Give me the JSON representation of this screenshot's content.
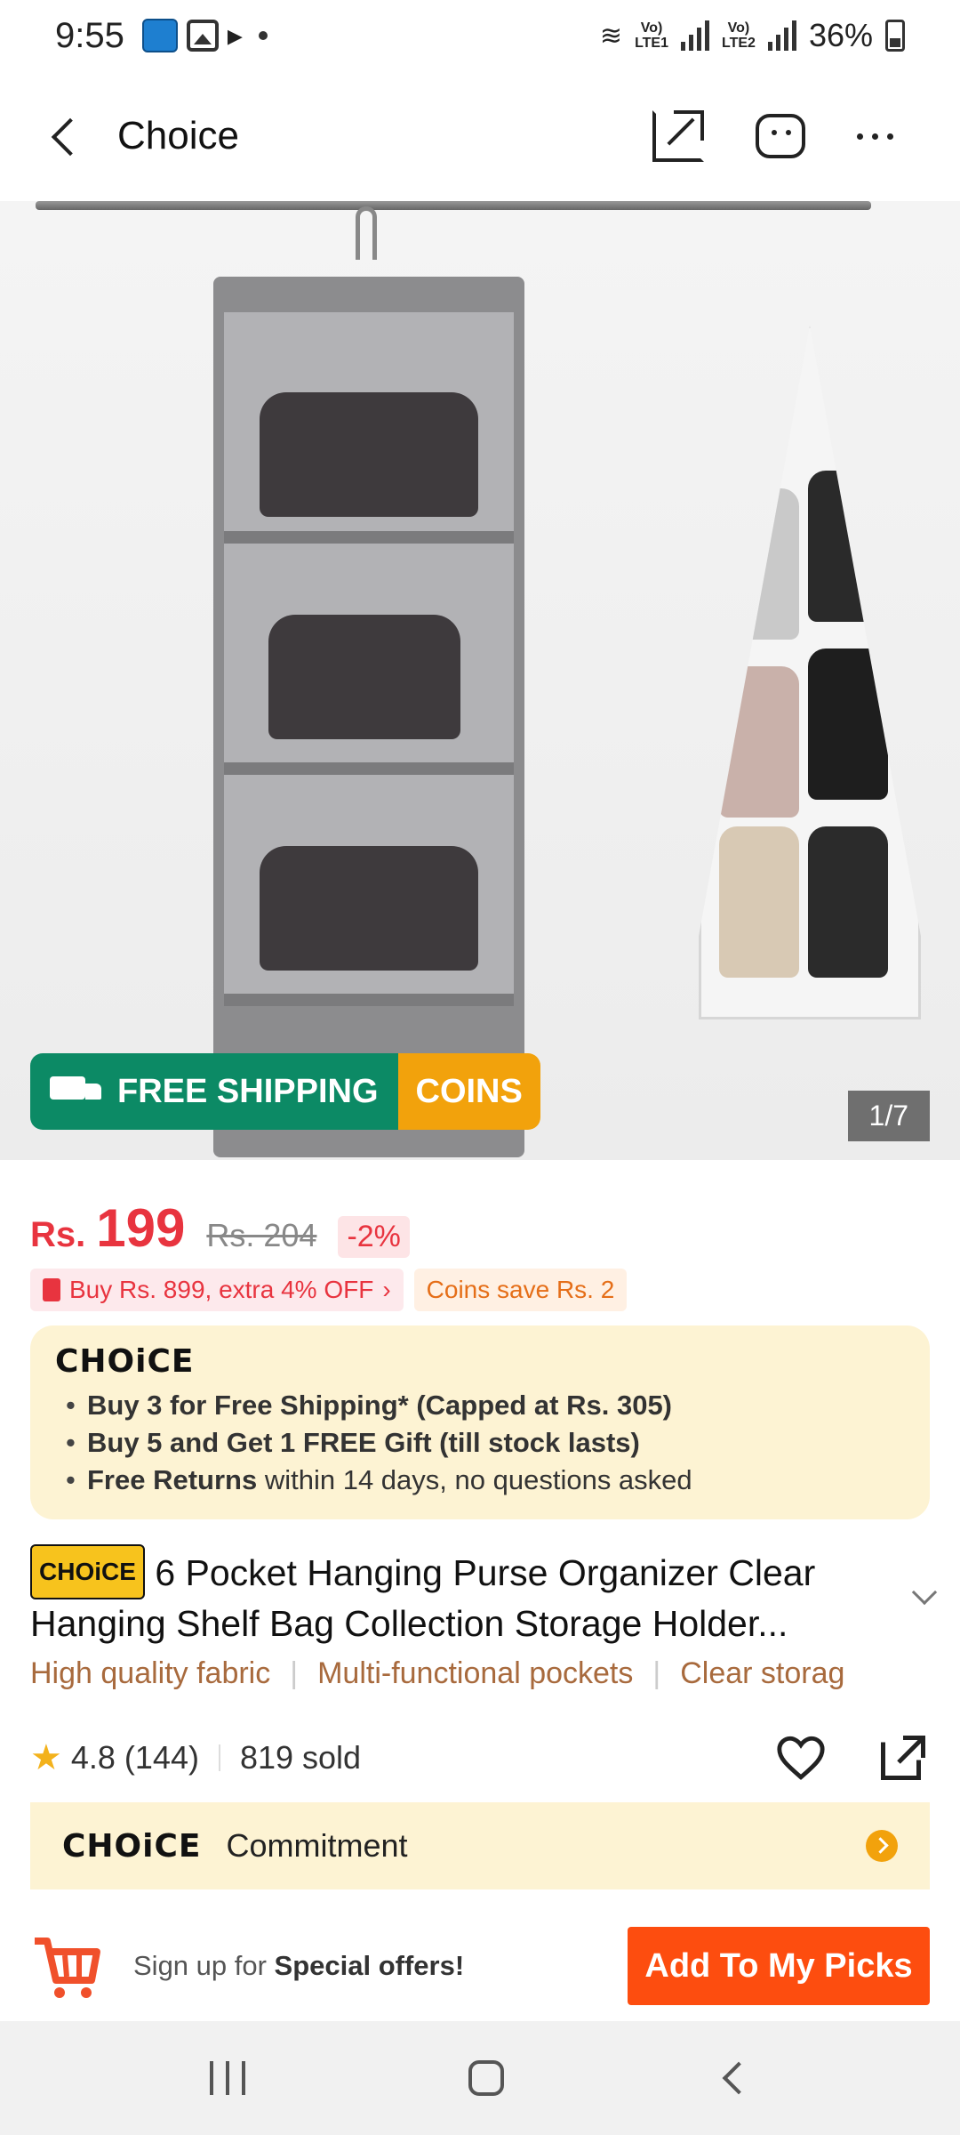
{
  "status_bar": {
    "time": "9:55",
    "lte1": "Vo)\nLTE1",
    "lte2": "Vo)\nLTE2",
    "battery": "36%"
  },
  "header": {
    "title": "Choice",
    "icons": [
      "back-icon",
      "share-icon",
      "customer-service-icon",
      "more-icon"
    ]
  },
  "gallery": {
    "banner_free_shipping": "FREE SHIPPING",
    "banner_free_tag": "FREE",
    "banner_coins": "COINS",
    "counter": "1/7"
  },
  "price": {
    "currency": "Rs.",
    "value": "199",
    "original": "Rs. 204",
    "discount": "-2%"
  },
  "promos": {
    "bundle": "Buy Rs. 899, extra 4% OFF",
    "coins": "Coins save Rs. 2"
  },
  "choice_card": {
    "logo": "CHOiCE",
    "line1": "Buy 3 for  Free Shipping* (Capped at Rs. 305)",
    "line2": "Buy 5 and Get 1 FREE Gift (till stock lasts)",
    "line3_bold": "Free Returns",
    "line3_rest": " within 14 days, no questions asked"
  },
  "product": {
    "badge": "CHOiCE",
    "title": "6 Pocket Hanging Purse Organizer Clear Hanging Shelf Bag Collection Storage Holder..."
  },
  "features": [
    "High quality fabric",
    "Multi-functional pockets",
    "Clear storag"
  ],
  "rating": {
    "score": "4.8",
    "count": "(144)",
    "sold": "819 sold"
  },
  "commitment": {
    "logo": "CHOiCE",
    "label": "Commitment"
  },
  "bottom": {
    "signup_prefix": "Sign up for ",
    "signup_bold": "Special offers!",
    "add_button": "Add To My Picks"
  },
  "colors": {
    "price_red": "#e8343f",
    "ship_green": "#0c8a65",
    "coins_orange": "#f2a20c",
    "choice_bg": "#fdf3d3",
    "cta_orange": "#fd4d0f"
  }
}
